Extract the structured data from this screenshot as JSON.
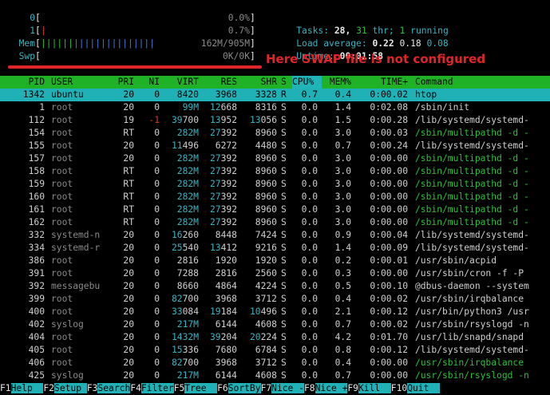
{
  "meters": {
    "cpu0": {
      "label": "0",
      "value": "0.0%",
      "fill": 0.0
    },
    "cpu1": {
      "label": "1",
      "value": "0.7%",
      "fill": 0.007
    },
    "mem": {
      "label": "Mem",
      "value": "162M/905M",
      "fill": 0.18
    },
    "swp": {
      "label": "Swp",
      "value": "0K/0K",
      "fill": 0.0
    }
  },
  "stats": {
    "tasks_label": "Tasks:",
    "tasks": "28,",
    "thr": "31",
    "thr_label": "thr;",
    "running": "1",
    "running_label": "running",
    "load_label": "Load average:",
    "load1": "0.22",
    "load5": "0.18",
    "load15": "0.08",
    "uptime_label": "Uptime:",
    "uptime": "00:01:58"
  },
  "annotation": "Here SWAP file is not configured",
  "columns": [
    "PID",
    "USER",
    "PRI",
    "NI",
    "VIRT",
    "RES",
    "SHR",
    "S",
    "CPU%",
    "MEM%",
    "TIME+",
    "Command"
  ],
  "rows": [
    [
      "1342",
      "ubuntu",
      "20",
      "0",
      "8420",
      "3968",
      "3328",
      "R",
      "0.7",
      "0.4",
      "0:00.02",
      "htop"
    ],
    [
      "1",
      "root",
      "20",
      "0",
      "99M",
      "12668",
      "8316",
      "S",
      "0.0",
      "1.4",
      "0:02.08",
      "/sbin/init"
    ],
    [
      "112",
      "root",
      "19",
      "-1",
      "39700",
      "13952",
      "13056",
      "S",
      "0.0",
      "1.5",
      "0:00.28",
      "/lib/systemd/systemd-"
    ],
    [
      "154",
      "root",
      "RT",
      "0",
      "282M",
      "27392",
      "8960",
      "S",
      "0.0",
      "3.0",
      "0:00.03",
      "/sbin/multipathd -d -"
    ],
    [
      "155",
      "root",
      "20",
      "0",
      "11496",
      "6272",
      "4480",
      "S",
      "0.0",
      "0.7",
      "0:00.24",
      "/lib/systemd/systemd-"
    ],
    [
      "157",
      "root",
      "20",
      "0",
      "282M",
      "27392",
      "8960",
      "S",
      "0.0",
      "3.0",
      "0:00.00",
      "/sbin/multipathd -d -"
    ],
    [
      "158",
      "root",
      "RT",
      "0",
      "282M",
      "27392",
      "8960",
      "S",
      "0.0",
      "3.0",
      "0:00.00",
      "/sbin/multipathd -d -"
    ],
    [
      "159",
      "root",
      "RT",
      "0",
      "282M",
      "27392",
      "8960",
      "S",
      "0.0",
      "3.0",
      "0:00.00",
      "/sbin/multipathd -d -"
    ],
    [
      "160",
      "root",
      "RT",
      "0",
      "282M",
      "27392",
      "8960",
      "S",
      "0.0",
      "3.0",
      "0:00.00",
      "/sbin/multipathd -d -"
    ],
    [
      "161",
      "root",
      "RT",
      "0",
      "282M",
      "27392",
      "8960",
      "S",
      "0.0",
      "3.0",
      "0:00.00",
      "/sbin/multipathd -d -"
    ],
    [
      "162",
      "root",
      "RT",
      "0",
      "282M",
      "27392",
      "8960",
      "S",
      "0.0",
      "3.0",
      "0:00.00",
      "/sbin/multipathd -d -"
    ],
    [
      "332",
      "systemd-n",
      "20",
      "0",
      "16260",
      "8448",
      "7424",
      "S",
      "0.0",
      "0.9",
      "0:00.04",
      "/lib/systemd/systemd-"
    ],
    [
      "334",
      "systemd-r",
      "20",
      "0",
      "25540",
      "13412",
      "9216",
      "S",
      "0.0",
      "1.4",
      "0:00.09",
      "/lib/systemd/systemd-"
    ],
    [
      "386",
      "root",
      "20",
      "0",
      "2816",
      "1920",
      "1920",
      "S",
      "0.0",
      "0.2",
      "0:00.01",
      "/usr/sbin/acpid"
    ],
    [
      "391",
      "root",
      "20",
      "0",
      "7288",
      "2816",
      "2560",
      "S",
      "0.0",
      "0.3",
      "0:00.00",
      "/usr/sbin/cron -f -P"
    ],
    [
      "392",
      "messagebu",
      "20",
      "0",
      "8660",
      "4864",
      "4224",
      "S",
      "0.0",
      "0.5",
      "0:00.10",
      "@dbus-daemon --system"
    ],
    [
      "399",
      "root",
      "20",
      "0",
      "82700",
      "3968",
      "3712",
      "S",
      "0.0",
      "0.4",
      "0:00.02",
      "/usr/sbin/irqbalance"
    ],
    [
      "400",
      "root",
      "20",
      "0",
      "33084",
      "19184",
      "10496",
      "S",
      "0.0",
      "2.1",
      "0:00.12",
      "/usr/bin/python3 /usr"
    ],
    [
      "402",
      "syslog",
      "20",
      "0",
      "217M",
      "6144",
      "4608",
      "S",
      "0.0",
      "0.7",
      "0:00.02",
      "/usr/sbin/rsyslogd -n"
    ],
    [
      "404",
      "root",
      "20",
      "0",
      "1432M",
      "39204",
      "20224",
      "S",
      "0.0",
      "4.2",
      "0:01.70",
      "/usr/lib/snapd/snapd"
    ],
    [
      "405",
      "root",
      "20",
      "0",
      "15336",
      "7680",
      "6784",
      "S",
      "0.0",
      "0.8",
      "0:00.12",
      "/lib/systemd/systemd-"
    ],
    [
      "406",
      "root",
      "20",
      "0",
      "82700",
      "3968",
      "3712",
      "S",
      "0.0",
      "0.4",
      "0:00.00",
      "/usr/sbin/irqbalance"
    ],
    [
      "425",
      "syslog",
      "20",
      "0",
      "217M",
      "6144",
      "4608",
      "S",
      "0.0",
      "0.7",
      "0:00.00",
      "/usr/sbin/rsyslogd -n"
    ]
  ],
  "thread_rows": [
    3,
    5,
    6,
    7,
    8,
    9,
    10,
    21,
    22
  ],
  "fkeys": [
    {
      "key": "F1",
      "label": "Help"
    },
    {
      "key": "F2",
      "label": "Setup"
    },
    {
      "key": "F3",
      "label": "Search"
    },
    {
      "key": "F4",
      "label": "Filter"
    },
    {
      "key": "F5",
      "label": "Tree"
    },
    {
      "key": "F6",
      "label": "SortBy"
    },
    {
      "key": "F7",
      "label": "Nice -"
    },
    {
      "key": "F8",
      "label": "Nice +"
    },
    {
      "key": "F9",
      "label": "Kill"
    },
    {
      "key": "F10",
      "label": "Quit"
    }
  ]
}
